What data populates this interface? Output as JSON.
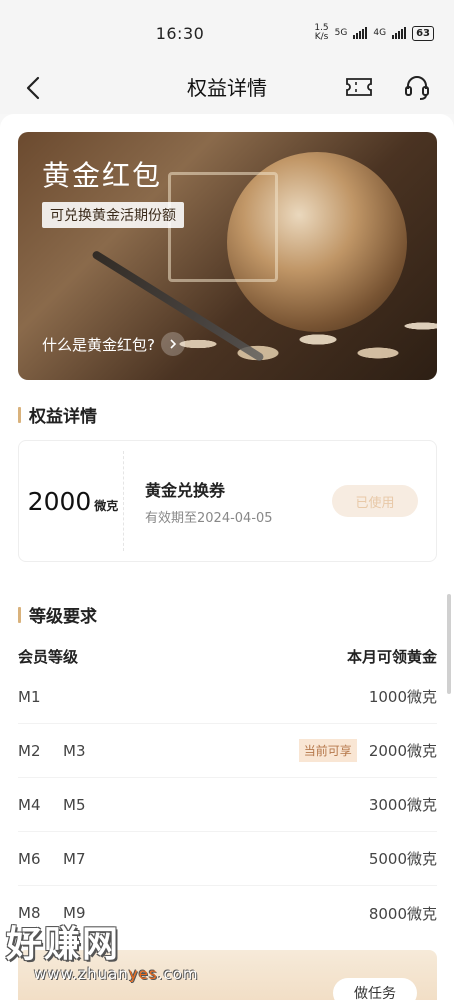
{
  "status": {
    "time": "16:30",
    "speed_top": "1.5",
    "speed_bottom": "K/s",
    "net1": "5G",
    "net2": "4G",
    "battery": "63"
  },
  "nav": {
    "title": "权益详情"
  },
  "banner": {
    "title": "黄金红包",
    "tag": "可兑换黄金活期份额",
    "link": "什么是黄金红包?"
  },
  "rights_section": {
    "title": "权益详情"
  },
  "voucher": {
    "amount": "2000",
    "unit": "微克",
    "name": "黄金兑换券",
    "expiry": "有效期至2024-04-05",
    "status": "已使用"
  },
  "level_section": {
    "title": "等级要求",
    "col_left": "会员等级",
    "col_right": "本月可领黄金",
    "rows": [
      {
        "levels": [
          "M1"
        ],
        "amount": "1000微克",
        "badge": ""
      },
      {
        "levels": [
          "M2",
          "M3"
        ],
        "amount": "2000微克",
        "badge": "当前可享"
      },
      {
        "levels": [
          "M4",
          "M5"
        ],
        "amount": "3000微克",
        "badge": ""
      },
      {
        "levels": [
          "M6",
          "M7"
        ],
        "amount": "5000微克",
        "badge": ""
      },
      {
        "levels": [
          "M8",
          "M9"
        ],
        "amount": "8000微克",
        "badge": ""
      }
    ]
  },
  "task_card": {
    "button": "做任务"
  },
  "watermark": {
    "main": "好赚网",
    "url_a": "www.zhuan",
    "url_b": "yes",
    "url_c": ".com"
  },
  "colors": {
    "accent": "#d9b27c",
    "badge_bg": "#f9e6d4",
    "badge_text": "#b5774a"
  }
}
